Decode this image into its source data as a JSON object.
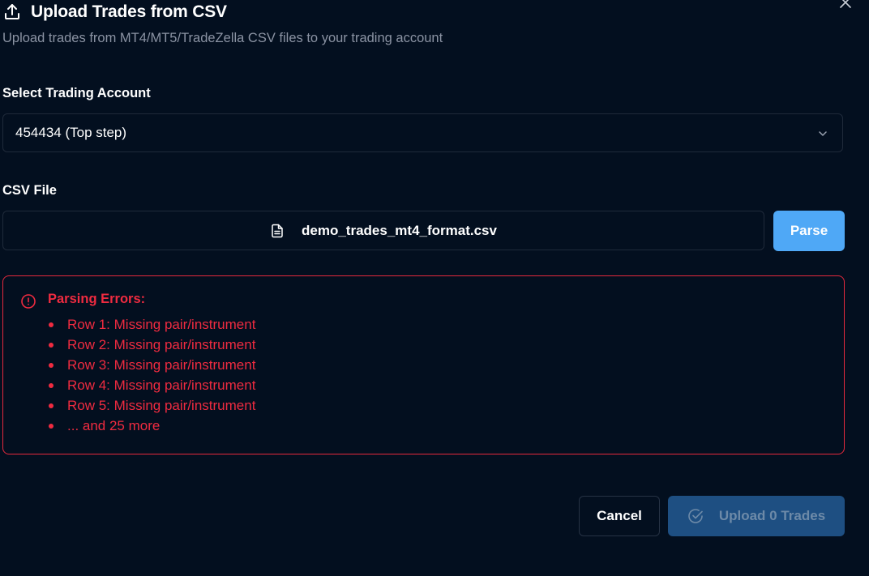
{
  "dialog": {
    "title": "Upload Trades from CSV",
    "subtitle": "Upload trades from MT4/MT5/TradeZella CSV files to your trading account",
    "title_icon": "upload-icon",
    "close_icon": "close-icon"
  },
  "account": {
    "label": "Select Trading Account",
    "selected": "454434 (Top step)",
    "chevron_icon": "chevron-down-icon"
  },
  "csv": {
    "label": "CSV File",
    "file_name": "demo_trades_mt4_format.csv",
    "file_icon": "file-text-icon",
    "parse_label": "Parse"
  },
  "errors": {
    "title": "Parsing Errors:",
    "icon": "alert-circle-icon",
    "items": [
      "Row 1: Missing pair/instrument",
      "Row 2: Missing pair/instrument",
      "Row 3: Missing pair/instrument",
      "Row 4: Missing pair/instrument",
      "Row 5: Missing pair/instrument",
      "... and 25 more"
    ]
  },
  "footer": {
    "cancel_label": "Cancel",
    "upload_label": "Upload 0 Trades",
    "upload_icon": "check-circle-icon"
  },
  "colors": {
    "background": "#030f1f",
    "border": "#1f2a3a",
    "accent": "#4fa8f6",
    "error": "#ef2b40",
    "disabled_button": "#1e4f82",
    "muted_text": "#8b93a3"
  }
}
